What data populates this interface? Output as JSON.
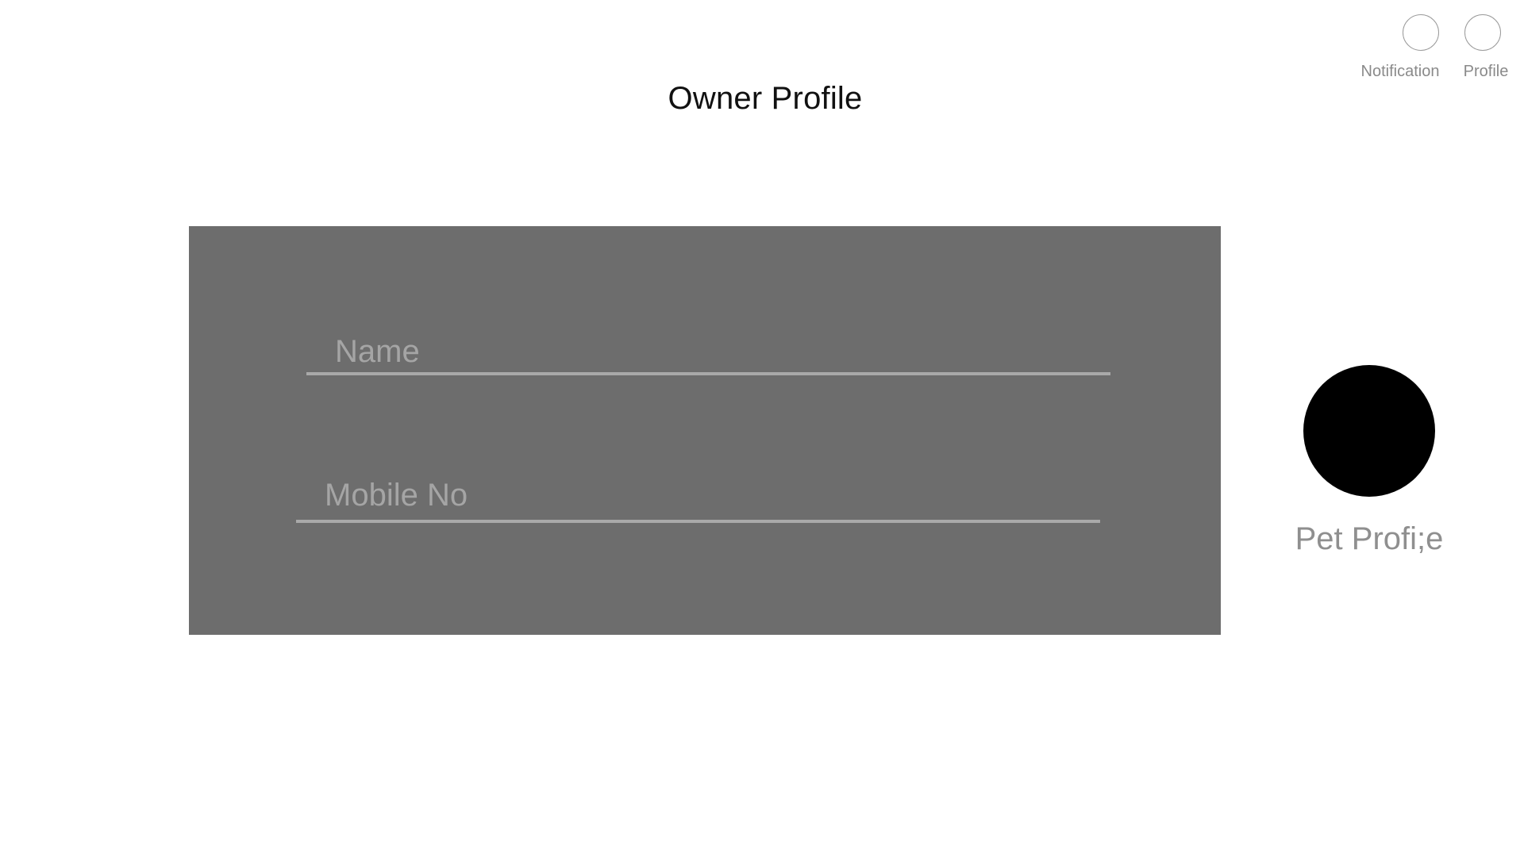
{
  "header": {
    "title": "Owner Profile",
    "notification_label": "Notification",
    "profile_label": "Profile"
  },
  "form": {
    "name": {
      "placeholder": "Name",
      "value": ""
    },
    "mobile": {
      "placeholder": "Mobile No",
      "value": ""
    }
  },
  "pet": {
    "label": "Pet Profi;e"
  },
  "colors": {
    "panel": "#6d6d6d",
    "underline": "#a9a9a9",
    "avatar": "#000000",
    "muted_text": "#8f8f8f"
  }
}
